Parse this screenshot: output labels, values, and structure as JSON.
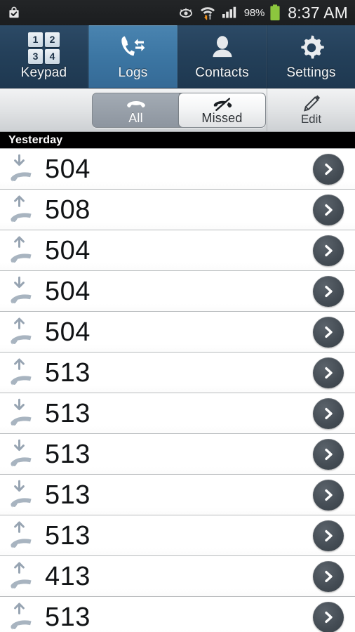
{
  "status_bar": {
    "left_icons": [
      {
        "name": "shopping-bag-check-icon",
        "label": "bag-with-check"
      }
    ],
    "right_icons": [
      {
        "name": "smart-stay-eye-icon",
        "label": "eye"
      },
      {
        "name": "wifi-transfer-icon",
        "label": "wifi-up-down"
      },
      {
        "name": "cellular-signal-icon",
        "label": "signal-bars"
      }
    ],
    "battery_percent": "98%",
    "battery_color": "#8cc63e",
    "clock": "8:37 AM"
  },
  "tabs": [
    {
      "label": "Keypad",
      "icon": "keypad-icon",
      "keys": [
        "1",
        "2",
        "3",
        "4"
      ],
      "selected": false
    },
    {
      "label": "Logs",
      "icon": "call-logs-icon",
      "selected": true
    },
    {
      "label": "Contacts",
      "icon": "contacts-person-icon",
      "selected": false
    },
    {
      "label": "Settings",
      "icon": "gear-icon",
      "selected": false
    }
  ],
  "toolbar": {
    "segments": [
      {
        "label": "All",
        "icon": "handset-icon",
        "selected": true
      },
      {
        "label": "Missed",
        "icon": "missed-call-icon",
        "selected": false
      }
    ],
    "edit": {
      "label": "Edit",
      "icon": "pencil-icon"
    }
  },
  "sections": [
    {
      "header": "Yesterday",
      "rows": [
        {
          "number": "504",
          "direction": "incoming",
          "icon": "incoming-call-icon",
          "chevron": "chevron-right-icon"
        },
        {
          "number": "508",
          "direction": "outgoing",
          "icon": "outgoing-call-icon",
          "chevron": "chevron-right-icon"
        },
        {
          "number": "504",
          "direction": "outgoing",
          "icon": "outgoing-call-icon",
          "chevron": "chevron-right-icon"
        },
        {
          "number": "504",
          "direction": "incoming",
          "icon": "incoming-call-icon",
          "chevron": "chevron-right-icon"
        },
        {
          "number": "504",
          "direction": "outgoing",
          "icon": "outgoing-call-icon",
          "chevron": "chevron-right-icon"
        },
        {
          "number": "513",
          "direction": "outgoing",
          "icon": "outgoing-call-icon",
          "chevron": "chevron-right-icon"
        },
        {
          "number": "513",
          "direction": "incoming",
          "icon": "incoming-call-icon",
          "chevron": "chevron-right-icon"
        },
        {
          "number": "513",
          "direction": "incoming",
          "icon": "incoming-call-icon",
          "chevron": "chevron-right-icon"
        },
        {
          "number": "513",
          "direction": "incoming",
          "icon": "incoming-call-icon",
          "chevron": "chevron-right-icon"
        },
        {
          "number": "513",
          "direction": "outgoing",
          "icon": "outgoing-call-icon",
          "chevron": "chevron-right-icon"
        },
        {
          "number": "413",
          "direction": "outgoing",
          "icon": "outgoing-call-icon",
          "chevron": "chevron-right-icon"
        },
        {
          "number": "513",
          "direction": "outgoing",
          "icon": "outgoing-call-icon",
          "chevron": "chevron-right-icon"
        }
      ]
    }
  ],
  "colors": {
    "tab_bar_bg": "#24405a",
    "tab_selected_bg": "#3c76a3",
    "date_header_bg": "#000000",
    "chevron_bg": "#454d55",
    "call_icon": "#a8b4c0",
    "status_bar_bg": "#1f2123"
  }
}
